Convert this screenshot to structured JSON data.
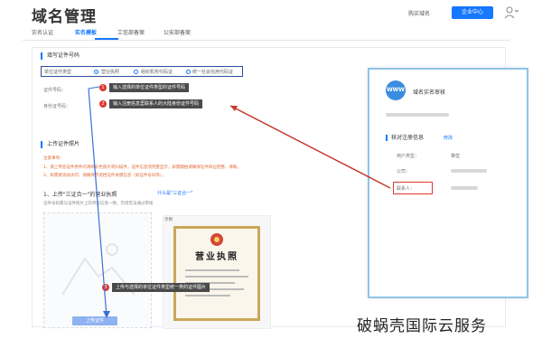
{
  "header": {
    "title": "域名管理",
    "link": "购买域名",
    "button": "企业中心"
  },
  "tabs": [
    "实名认证",
    "实名模板",
    "工信部备案",
    "公安部备案"
  ],
  "form": {
    "section1_title": "填写证件号码",
    "radio_group_label": "单位证件类型",
    "radio_options": [
      "营业执照",
      "组织机构代码证",
      "统一社会信用代码证"
    ],
    "field1_label": "证件号码：",
    "field2_label": "身份证号码：",
    "annotation1_num": "1",
    "annotation1": "输入选择的单位证件类型的证件号码",
    "annotation2_num": "2",
    "annotation2": "输入注册信息里联系人的大陆身份证件号码",
    "section2_title": "上传证件照片",
    "notice_title": "注意事项：",
    "notice_lines": [
      "1、请上传您证件原件的清晰彩色照片或扫描件，证件信息须完整显示，如需翻拍请确保证件四边完整、清晰。",
      "2、如需要添加水印，请确保不遮挡证件关键信息（如证件号码等）。"
    ],
    "step1": "1、上传\"三证合一\"的营业执照",
    "sample_link": "什么是\"三证合一\"",
    "upload_hint": "证件号码需与证件照片上的单位信息一致，否则无法通过审核",
    "sample_tag": "示例",
    "license_title": "营业执照",
    "annotation3_num": "3",
    "annotation3": "上传与选择的单位证件类型统一类的证件图片",
    "upload_button": "上传证件"
  },
  "popup": {
    "icon_text": "WWW",
    "title": "域名实名审核",
    "section": "核对注册信息",
    "edit_link": "修改",
    "rows": [
      {
        "label": "用户类型：",
        "value": "单位"
      },
      {
        "label": "公司：",
        "value": ""
      },
      {
        "label": "联系人：",
        "value": ""
      }
    ]
  },
  "watermark": "破蜗壳国际云服务",
  "colors": {
    "accent": "#1677ff",
    "annotation_bg": "#4a4a4a",
    "marker": "#e0382e",
    "arrow": "#c33a2f"
  }
}
